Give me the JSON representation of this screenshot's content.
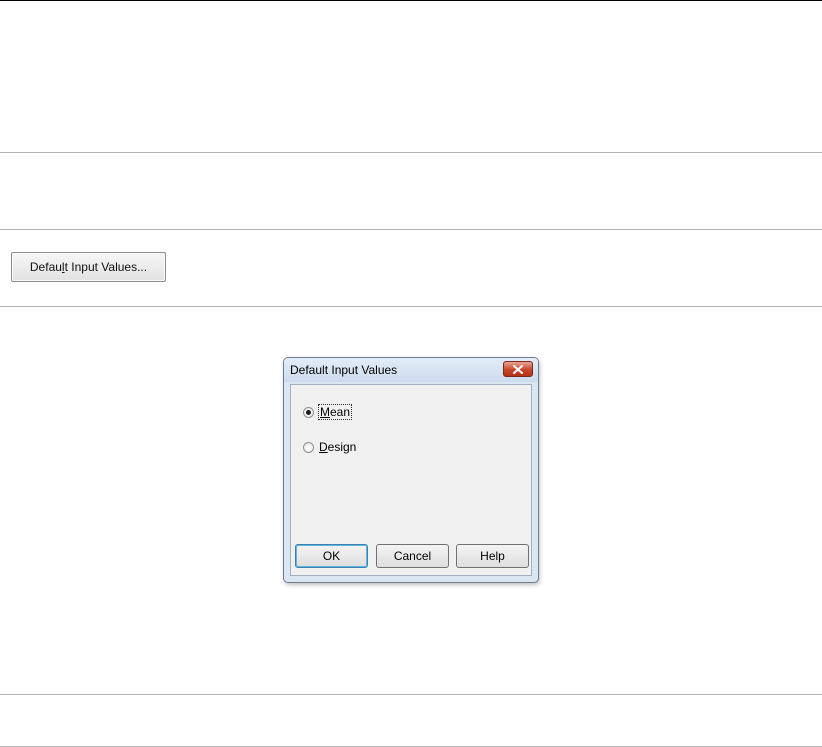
{
  "launcher": {
    "label_pre": "Defau",
    "label_mn": "l",
    "label_post": "t Input Values..."
  },
  "dialog": {
    "title": "Default Input Values",
    "close_icon": "close-icon",
    "options": [
      {
        "mn": "M",
        "rest": "ean",
        "checked": true
      },
      {
        "mn": "D",
        "rest": "esign",
        "checked": false
      }
    ],
    "buttons": {
      "ok": "OK",
      "cancel": "Cancel",
      "help": "Help"
    }
  }
}
